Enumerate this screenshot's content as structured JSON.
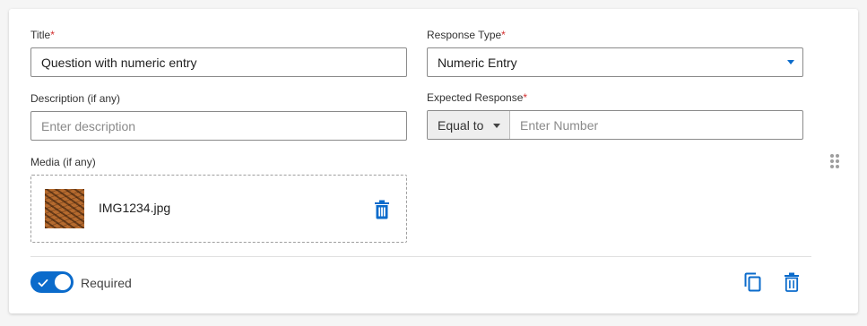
{
  "form": {
    "title_label": "Title",
    "title_value": "Question with numeric entry",
    "response_type_label": "Response Type",
    "response_type_value": "Numeric Entry",
    "description_label": "Description (if any)",
    "description_placeholder": "Enter description",
    "expected_response_label": "Expected Response",
    "operator_value": "Equal to",
    "number_placeholder": "Enter Number",
    "media_label": "Media (if any)",
    "media_filename": "IMG1234.jpg",
    "required_label": "Required",
    "required_on": true,
    "required_marker": "*"
  },
  "colors": {
    "accent": "#0b6bcb",
    "required_star": "#d32f2f"
  },
  "icons": [
    "trash-icon",
    "copy-icon",
    "drag-handle-icon",
    "check-icon",
    "dropdown-arrow-icon"
  ]
}
